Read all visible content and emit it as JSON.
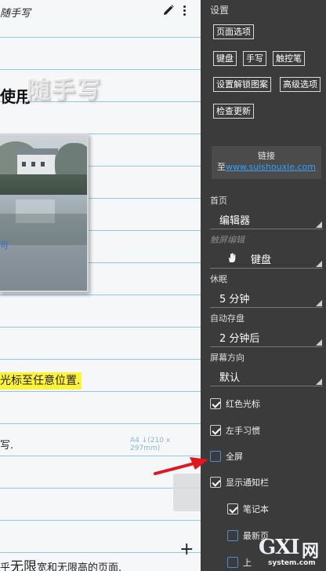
{
  "page": {
    "title": "随手写",
    "use_text": "使用",
    "logo_text": "随手写",
    "image_hint": "可",
    "highlight_text": "光标至任意位置.",
    "write_text": "写.",
    "page_size_label": "A4 ↓(210 x 297mm)",
    "bottom_prefix": "乎",
    "bottom_big": "无限",
    "bottom_suffix": "宽和无限高的页面.",
    "add_label": "+"
  },
  "drawer": {
    "settings_label": "设置",
    "buttons": {
      "page_options": "页面选项",
      "keyboard": "键盘",
      "handwriting": "手写",
      "touch_pen": "触控笔",
      "unlock_pattern": "设置解锁图案",
      "advanced": "高级选项",
      "check_update": "检查更新"
    },
    "link": {
      "title": "链接",
      "prefix": "至",
      "url": "www.suishouxie.com"
    },
    "home": {
      "label": "首页",
      "value": "编辑器"
    },
    "touch_edit": {
      "label": "触屏编辑",
      "value": "键盘",
      "icon": "hand-icon"
    },
    "sleep": {
      "label": "休眠",
      "value": "5 分钟"
    },
    "autosave": {
      "label": "自动存盘",
      "value": "2 分钟后"
    },
    "orientation": {
      "label": "屏幕方向",
      "value": "默认"
    },
    "checkboxes": {
      "red_cursor": {
        "label": "红色光标",
        "checked": true
      },
      "left_handed": {
        "label": "左手习惯",
        "checked": true
      },
      "fullscreen": {
        "label": "全屏",
        "checked": false
      },
      "notification_bar": {
        "label": "显示通知栏",
        "checked": true
      },
      "notebook": {
        "label": "笔记本",
        "checked": true
      },
      "latest_page": {
        "label": "最新页",
        "checked": false
      },
      "prev_page": {
        "label": "上",
        "checked": false
      }
    }
  },
  "watermark": {
    "g": "G",
    "x": "X",
    "i": "I",
    "wang": "网",
    "site": "system.com"
  },
  "colors": {
    "link": "#3c9ff4",
    "highlight": "#fff23a",
    "rule_line": "#8ec8e4",
    "drawer_bg": "#3b3b3b",
    "arrow": "#e0181d"
  }
}
